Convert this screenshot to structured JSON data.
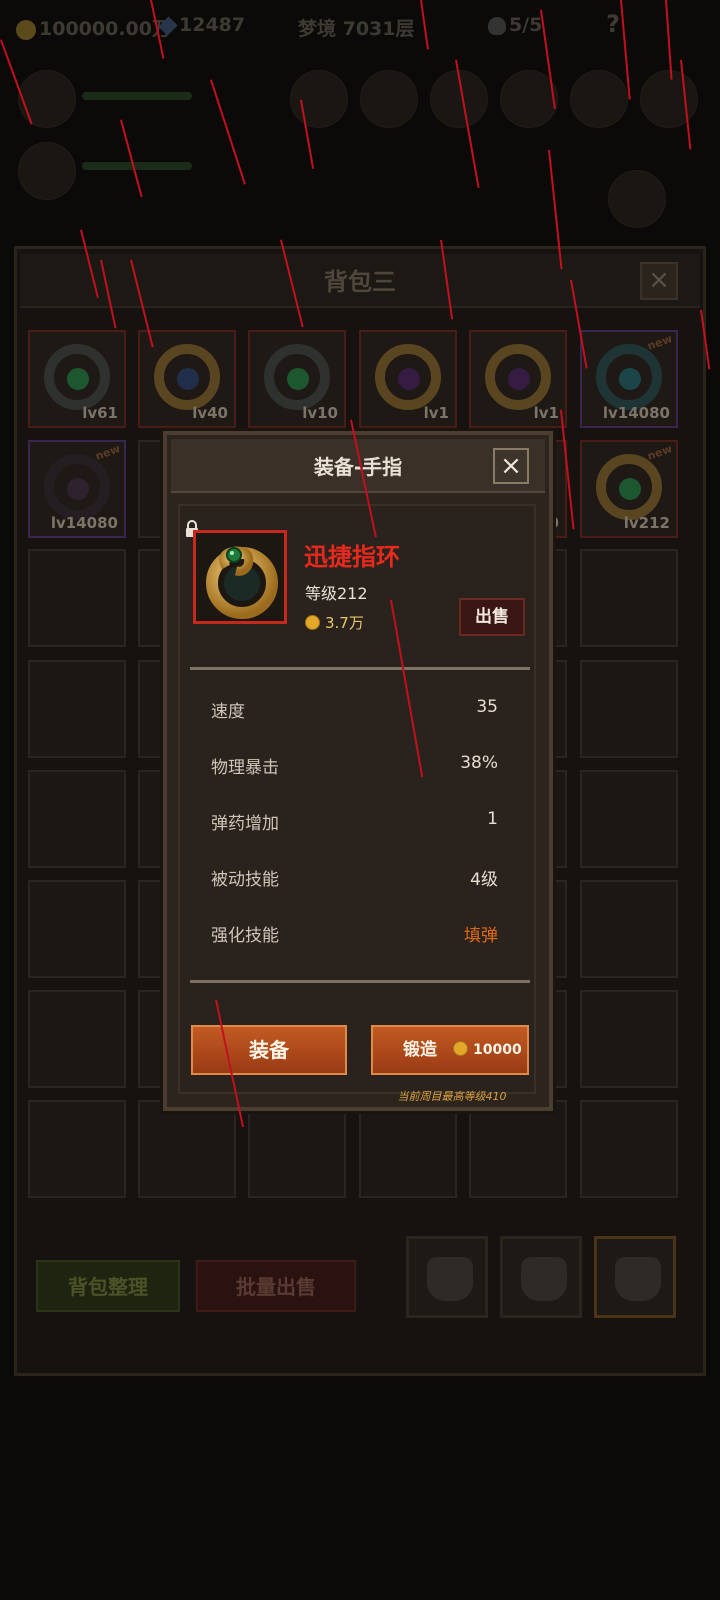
{
  "top_bar": {
    "gold": "100000.00万",
    "gems": "12487",
    "dream_level": "梦境 7031层",
    "skulls": "5/5",
    "help": "?"
  },
  "bag": {
    "title": "背包三",
    "close_icon": "close-icon",
    "items": [
      {
        "level": "lv61",
        "icon": "ring-green-gem",
        "new": ""
      },
      {
        "level": "lv40",
        "icon": "ring-blue-gem",
        "new": ""
      },
      {
        "level": "lv10",
        "icon": "ring-green-gem",
        "new": ""
      },
      {
        "level": "lv1",
        "icon": "ring-purple-gem",
        "new": ""
      },
      {
        "level": "lv1",
        "icon": "ring-purple-gem",
        "new": ""
      },
      {
        "level": "lv14080",
        "icon": "ring-teal-orb",
        "new": "new"
      },
      {
        "level": "lv14080",
        "icon": "ring-dark-claw",
        "new": "new"
      },
      {
        "level": "080",
        "icon": "ring-unknown",
        "new": ""
      },
      {
        "level": "lv212",
        "icon": "ring-gold-green-gem",
        "new": "new"
      }
    ],
    "sort_button": "背包整理",
    "batch_sell_button": "批量出售"
  },
  "dialog": {
    "title": "装备-手指",
    "item_name": "迅捷指环",
    "item_level": "等级212",
    "price": "3.7万",
    "sell_button": "出售",
    "stats": [
      {
        "label": "速度",
        "value": "35"
      },
      {
        "label": "物理暴击",
        "value": "38%"
      },
      {
        "label": "弹药增加",
        "value": "1"
      },
      {
        "label": "被动技能",
        "value": "4级"
      },
      {
        "label": "强化技能",
        "value": "填弹"
      }
    ],
    "equip_button": "装备",
    "forge_button": "锻造",
    "forge_cost": "10000",
    "max_level_note": "当前周目最高等级410"
  },
  "colors": {
    "item_name": "#e8291e",
    "rare_frame": "#c6281c",
    "button_orange": "#c25a22",
    "enhance_skill": "#e36a14",
    "gold_text": "#e9c66a"
  }
}
